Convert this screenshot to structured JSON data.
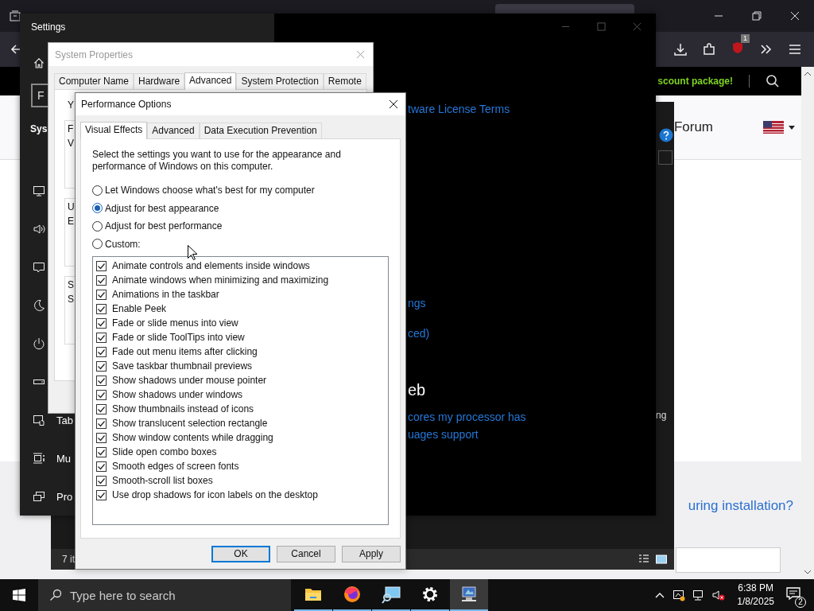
{
  "browser": {
    "extension_badge": "1",
    "banner": "scount package!",
    "nav_link": "Forum",
    "question_link": "uring installation?"
  },
  "settings": {
    "title": "Settings",
    "search_text": "F",
    "heading": "Sys",
    "nav_items": [
      {
        "kind": "display"
      },
      {
        "kind": "sound"
      },
      {
        "kind": "notifications"
      },
      {
        "kind": "moon"
      },
      {
        "kind": "power"
      },
      {
        "kind": "storage"
      },
      {
        "kind": "tablet",
        "label": "Tab"
      },
      {
        "kind": "multitask",
        "label": "Mu"
      },
      {
        "kind": "project",
        "label": "Pro"
      }
    ],
    "content": [
      {
        "kind": "link",
        "text": "tware License Terms"
      },
      {
        "kind": "link",
        "text": "ngs"
      },
      {
        "kind": "link",
        "text": "ced)"
      },
      {
        "kind": "heading",
        "text": "eb"
      },
      {
        "kind": "link",
        "text": "cores my processor has"
      },
      {
        "kind": "link",
        "text": "uages support"
      }
    ]
  },
  "explorer": {
    "side_text": "ng",
    "status": "7 it"
  },
  "system_properties": {
    "title": "System Properties",
    "tabs": [
      {
        "label": "Computer Name",
        "selected": false
      },
      {
        "label": "Hardware",
        "selected": false
      },
      {
        "label": "Advanced",
        "selected": true
      },
      {
        "label": "System Protection",
        "selected": false
      },
      {
        "label": "Remote",
        "selected": false
      }
    ],
    "intro": "Y",
    "groups": [
      {
        "title": "F",
        "text": "V"
      },
      {
        "title": "U",
        "text": "E"
      },
      {
        "title": "S",
        "text": "S"
      }
    ]
  },
  "performance_options": {
    "title": "Performance Options",
    "tabs": [
      {
        "label": "Visual Effects",
        "selected": true
      },
      {
        "label": "Advanced",
        "selected": false
      },
      {
        "label": "Data Execution Prevention",
        "selected": false
      }
    ],
    "intro": "Select the settings you want to use for the appearance and performance of Windows on this computer.",
    "options": [
      {
        "label": "Let Windows choose what's best for my computer",
        "selected": false
      },
      {
        "label": "Adjust for best appearance",
        "selected": true
      },
      {
        "label": "Adjust for best performance",
        "selected": false
      },
      {
        "label": "Custom:",
        "selected": false
      }
    ],
    "effects": [
      {
        "label": "Animate controls and elements inside windows",
        "checked": true
      },
      {
        "label": "Animate windows when minimizing and maximizing",
        "checked": true
      },
      {
        "label": "Animations in the taskbar",
        "checked": true
      },
      {
        "label": "Enable Peek",
        "checked": true
      },
      {
        "label": "Fade or slide menus into view",
        "checked": true
      },
      {
        "label": "Fade or slide ToolTips into view",
        "checked": true
      },
      {
        "label": "Fade out menu items after clicking",
        "checked": true
      },
      {
        "label": "Save taskbar thumbnail previews",
        "checked": true
      },
      {
        "label": "Show shadows under mouse pointer",
        "checked": true
      },
      {
        "label": "Show shadows under windows",
        "checked": true
      },
      {
        "label": "Show thumbnails instead of icons",
        "checked": true
      },
      {
        "label": "Show translucent selection rectangle",
        "checked": true
      },
      {
        "label": "Show window contents while dragging",
        "checked": true
      },
      {
        "label": "Slide open combo boxes",
        "checked": true
      },
      {
        "label": "Smooth edges of screen fonts",
        "checked": true
      },
      {
        "label": "Smooth-scroll list boxes",
        "checked": true
      },
      {
        "label": "Use drop shadows for icon labels on the desktop",
        "checked": true
      }
    ],
    "buttons": [
      {
        "label": "OK",
        "default": true
      },
      {
        "label": "Cancel",
        "default": false
      },
      {
        "label": "Apply",
        "default": false
      }
    ]
  },
  "taskbar": {
    "search_placeholder": "Type here to search",
    "apps": [
      {
        "kind": "folder",
        "selected": false
      },
      {
        "kind": "browser",
        "selected": false
      },
      {
        "kind": "remote",
        "selected": false
      },
      {
        "kind": "gear",
        "selected": false
      },
      {
        "kind": "system",
        "selected": true
      }
    ],
    "time": "6:38 PM",
    "date": "1/8/2025",
    "notification_count": "2"
  }
}
